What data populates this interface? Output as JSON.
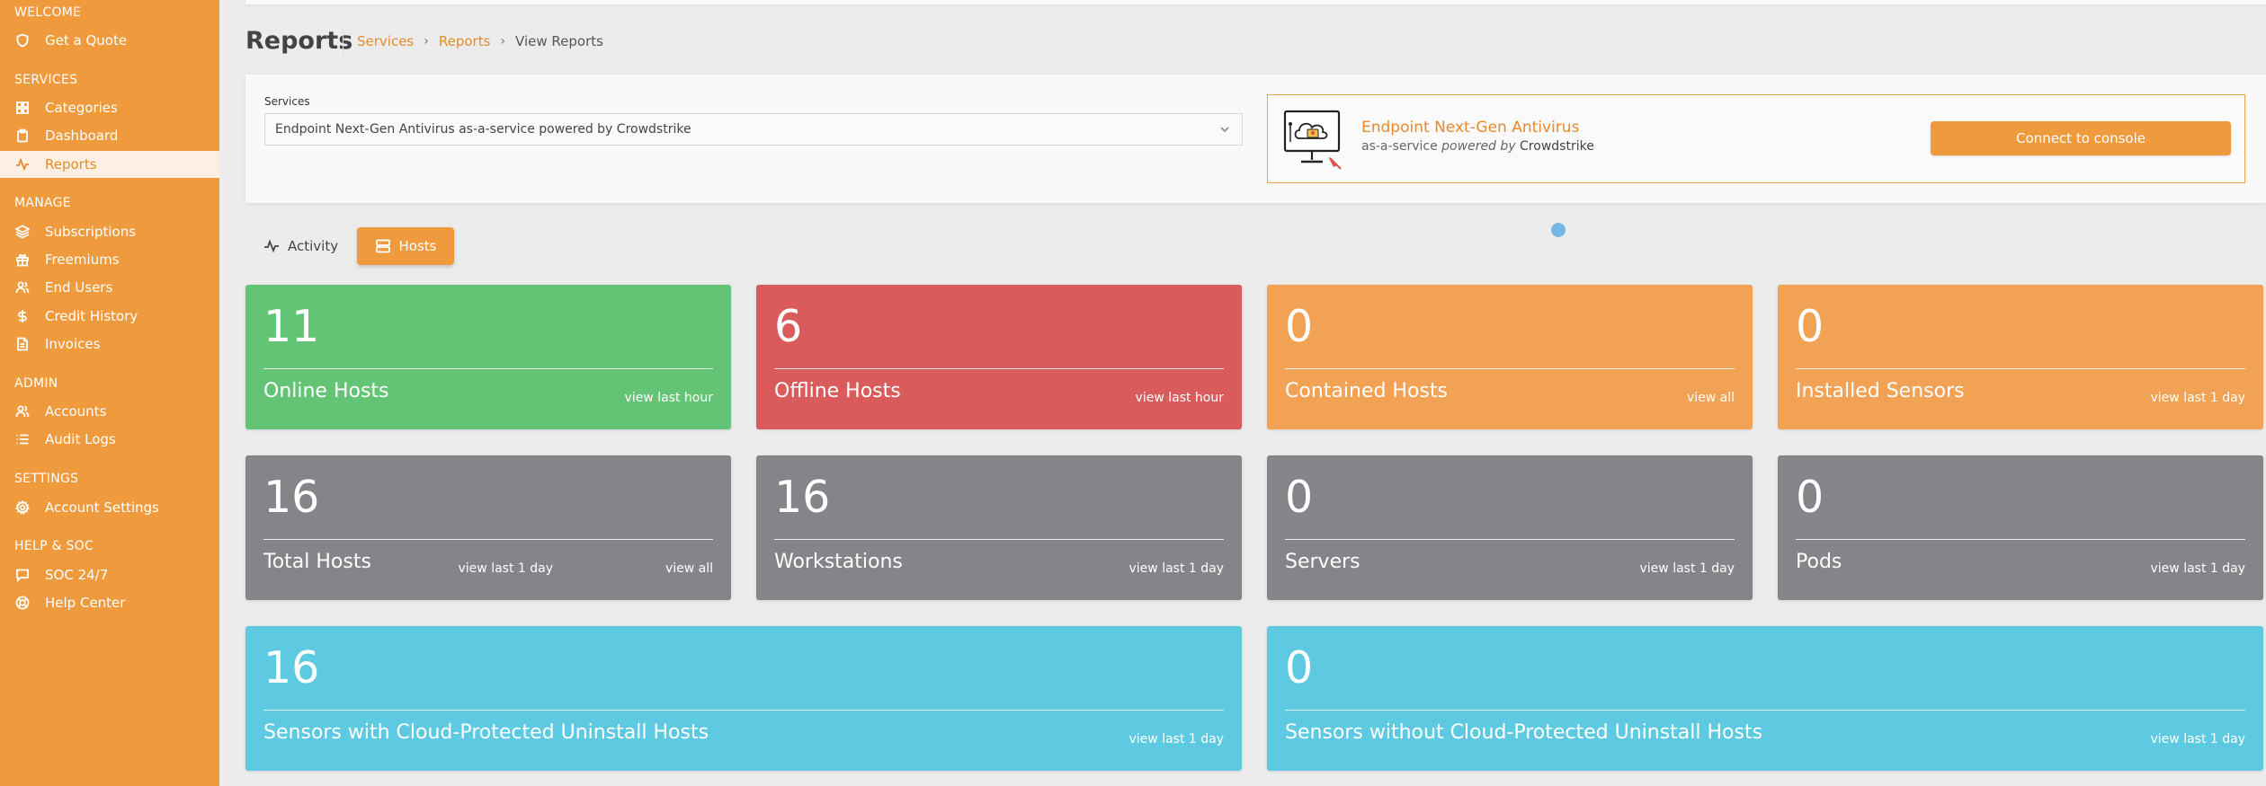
{
  "sidebar": {
    "sections": [
      {
        "title": "WELCOME",
        "items": [
          {
            "label": "Get a Quote",
            "icon": "shield-icon"
          }
        ]
      },
      {
        "title": "SERVICES",
        "items": [
          {
            "label": "Categories",
            "icon": "grid-icon"
          },
          {
            "label": "Dashboard",
            "icon": "clipboard-icon"
          },
          {
            "label": "Reports",
            "icon": "activity-icon",
            "active": true
          }
        ]
      },
      {
        "title": "MANAGE",
        "items": [
          {
            "label": "Subscriptions",
            "icon": "layers-icon"
          },
          {
            "label": "Freemiums",
            "icon": "gift-icon"
          },
          {
            "label": "End Users",
            "icon": "users-icon"
          },
          {
            "label": "Credit History",
            "icon": "dollar-icon"
          },
          {
            "label": "Invoices",
            "icon": "file-icon"
          }
        ]
      },
      {
        "title": "ADMIN",
        "items": [
          {
            "label": "Accounts",
            "icon": "users-icon"
          },
          {
            "label": "Audit Logs",
            "icon": "list-icon"
          }
        ]
      },
      {
        "title": "SETTINGS",
        "items": [
          {
            "label": "Account Settings",
            "icon": "gear-icon"
          }
        ]
      },
      {
        "title": "HELP & SOC",
        "items": [
          {
            "label": "SOC 24/7",
            "icon": "message-icon"
          },
          {
            "label": "Help Center",
            "icon": "lifebuoy-icon"
          }
        ]
      }
    ]
  },
  "header": {
    "title": "Reports",
    "breadcrumb": [
      "Services",
      "Reports",
      "View Reports"
    ]
  },
  "services": {
    "label": "Services",
    "selected": "Endpoint Next-Gen Antivirus as-a-service powered by Crowdstrike"
  },
  "product": {
    "name": "Endpoint Next-Gen Antivirus",
    "sub_prefix": "as-a-service",
    "sub_powered": "powered by",
    "sub_brand": "Crowdstrike",
    "connect_label": "Connect to console"
  },
  "tabs": {
    "activity": "Activity",
    "hosts": "Hosts"
  },
  "cards": {
    "online": {
      "value": "11",
      "label": "Online Hosts",
      "link": "view last hour"
    },
    "offline": {
      "value": "6",
      "label": "Offline Hosts",
      "link": "view last hour"
    },
    "contained": {
      "value": "0",
      "label": "Contained Hosts",
      "link": "view all"
    },
    "installed": {
      "value": "0",
      "label": "Installed Sensors",
      "link": "view last 1 day"
    },
    "total": {
      "value": "16",
      "label": "Total Hosts",
      "link": "view last 1 day",
      "link2": "view all"
    },
    "workstations": {
      "value": "16",
      "label": "Workstations",
      "link": "view last 1 day"
    },
    "servers": {
      "value": "0",
      "label": "Servers",
      "link": "view last 1 day"
    },
    "pods": {
      "value": "0",
      "label": "Pods",
      "link": "view last 1 day"
    },
    "with_cpu": {
      "value": "16",
      "label": "Sensors with Cloud-Protected Uninstall Hosts",
      "link": "view last 1 day"
    },
    "without_cpu": {
      "value": "0",
      "label": "Sensors without Cloud-Protected Uninstall Hosts",
      "link": "view last 1 day"
    }
  },
  "colors": {
    "accent": "#f09a3e",
    "green": "#63c475",
    "red": "#d95b5b",
    "orange": "#f2a254",
    "gray": "#838589",
    "cyan": "#5ecae2"
  }
}
